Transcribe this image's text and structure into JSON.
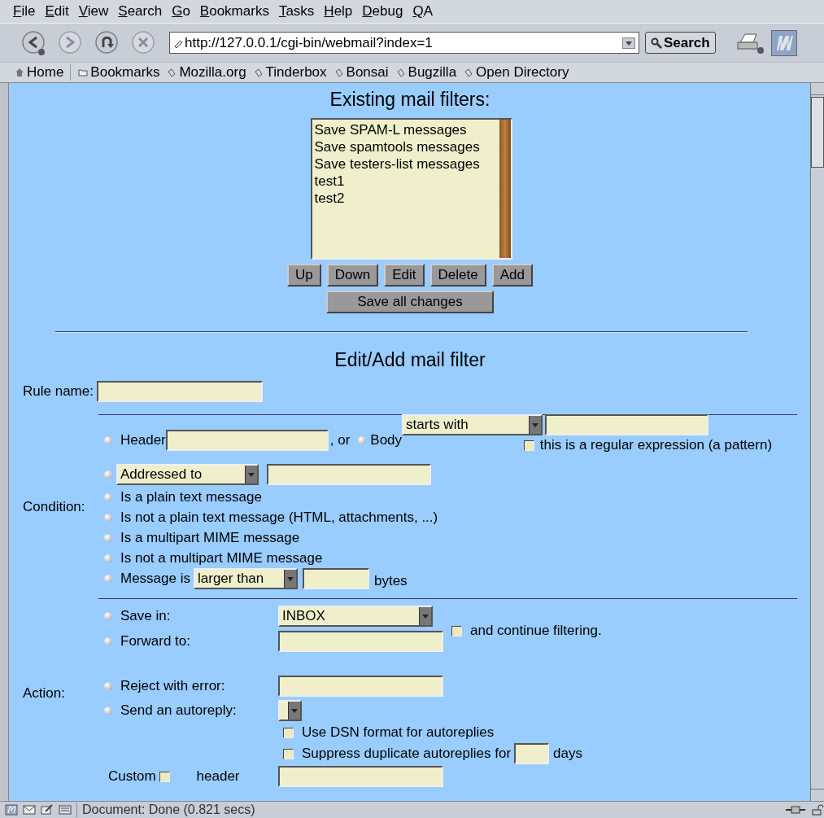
{
  "menu": [
    "File",
    "Edit",
    "View",
    "Search",
    "Go",
    "Bookmarks",
    "Tasks",
    "Help",
    "Debug",
    "QA"
  ],
  "navigation": {
    "url": "http://127.0.0.1/cgi-bin/webmail?index=1",
    "search_button": "Search"
  },
  "bookmarks": [
    {
      "kind": "home",
      "label": "Home"
    },
    {
      "kind": "folder",
      "label": "Bookmarks"
    },
    {
      "kind": "link",
      "label": "Mozilla.org"
    },
    {
      "kind": "link",
      "label": "Tinderbox"
    },
    {
      "kind": "link",
      "label": "Bonsai"
    },
    {
      "kind": "link",
      "label": "Bugzilla"
    },
    {
      "kind": "link",
      "label": "Open Directory"
    }
  ],
  "filters": {
    "title": "Existing mail filters:",
    "items": [
      {
        "label": "Save SPAM-L messages",
        "selected": false
      },
      {
        "label": "Save spamtools messages",
        "selected": false
      },
      {
        "label": "Save testers-list messages",
        "selected": false
      },
      {
        "label": "test1",
        "selected": false
      },
      {
        "label": "test2",
        "selected": false
      }
    ],
    "buttons": [
      "Up",
      "Down",
      "Edit",
      "Delete",
      "Add"
    ],
    "save_button": "Save all changes"
  },
  "edit": {
    "title": "Edit/Add mail filter",
    "rule_name_label": "Rule name:"
  },
  "condition": {
    "label": "Condition:",
    "rows": [
      {
        "kind": "header_body",
        "selected": false,
        "header_label": "Header",
        "or_text": ", or",
        "body_selected": false,
        "body_label": "Body",
        "match_select": "starts with",
        "regex_checked": false,
        "regex_label": "this is a regular expression (a pattern)"
      },
      {
        "kind": "address",
        "selected": false,
        "select": "Addressed to"
      },
      {
        "kind": "text",
        "selected": false,
        "label": "Is a plain text message"
      },
      {
        "kind": "text",
        "selected": false,
        "label": "Is not a plain text message (HTML, attachments, ...)"
      },
      {
        "kind": "text",
        "selected": false,
        "label": "Is a multipart MIME message"
      },
      {
        "kind": "text",
        "selected": false,
        "label": "Is not a multipart MIME message"
      },
      {
        "kind": "size",
        "selected": false,
        "label": "Message is",
        "select": "larger than",
        "unit": "bytes"
      }
    ]
  },
  "action": {
    "label": "Action:",
    "save_label": "Save in:",
    "save_selected": false,
    "save_select": "INBOX",
    "continue_checked": false,
    "continue_label": "and continue filtering.",
    "forward_label": "Forward to:",
    "forward_selected": false,
    "reject_label": "Reject with error:",
    "reject_selected": false,
    "autoreply_label": "Send an autoreply:",
    "autoreply_selected": false,
    "dsn_checked": false,
    "dsn_label": "Use DSN format for autoreplies",
    "suppress_checked": false,
    "suppress_label": "Suppress duplicate autoreplies for",
    "suppress_unit": "days",
    "custom_label": "Custom",
    "custom_checked": false,
    "header_label": "header"
  },
  "status_bar": {
    "text": "Document: Done (0.821 secs)"
  }
}
